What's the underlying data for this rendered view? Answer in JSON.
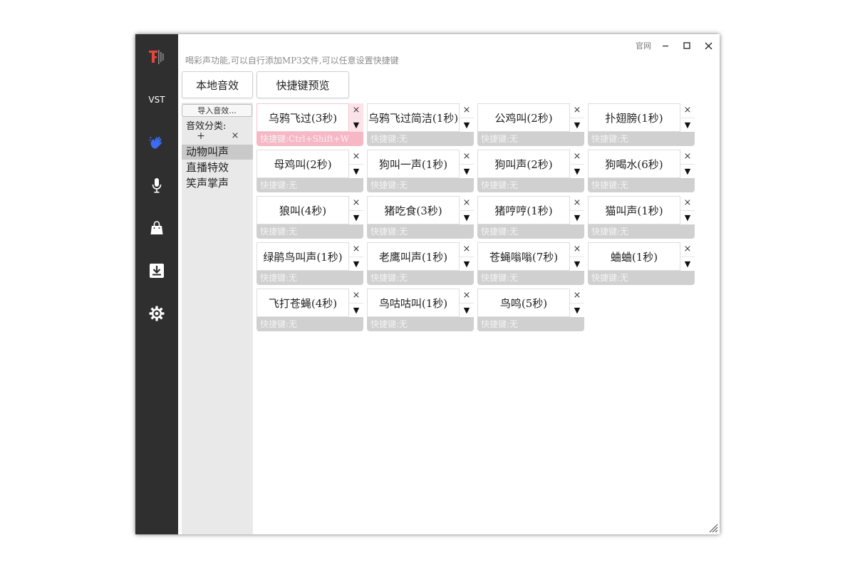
{
  "window": {
    "hint": "喝彩声功能,可以自行添加MP3文件,可以任意设置快捷键",
    "official_site": "官网",
    "minimize": "–",
    "maximize": "☐",
    "close": "✕"
  },
  "sidebar": {
    "items": [
      {
        "name": "logo-icon"
      },
      {
        "label": "VST"
      },
      {
        "name": "wave-hand-icon",
        "color": "#3b6cf6"
      },
      {
        "name": "microphone-icon"
      },
      {
        "name": "shopping-bag-icon"
      },
      {
        "name": "download-icon"
      },
      {
        "name": "gear-icon"
      }
    ]
  },
  "tabs": {
    "local": "本地音效",
    "preview": "快捷键预览"
  },
  "categories": {
    "import_label": "导入音效...",
    "title": "音效分类:",
    "add": "+",
    "remove": "×",
    "items": [
      "动物叫声",
      "直播特效",
      "笑声掌声"
    ],
    "selected": "动物叫声"
  },
  "sounds": [
    {
      "title": "乌鸦飞过(3秒)",
      "hotkey": "快捷键:Ctrl+Shift+W",
      "highlight": true
    },
    {
      "title": "乌鸦飞过简洁(1秒)",
      "hotkey": "快捷键:无"
    },
    {
      "title": "公鸡叫(2秒)",
      "hotkey": "快捷键:无"
    },
    {
      "title": "扑翅膀(1秒)",
      "hotkey": "快捷键:无"
    },
    {
      "title": "母鸡叫(2秒)",
      "hotkey": "快捷键:无"
    },
    {
      "title": "狗叫一声(1秒)",
      "hotkey": "快捷键:无"
    },
    {
      "title": "狗叫声(2秒)",
      "hotkey": "快捷键:无"
    },
    {
      "title": "狗喝水(6秒)",
      "hotkey": "快捷键:无"
    },
    {
      "title": "狼叫(4秒)",
      "hotkey": "快捷键:无"
    },
    {
      "title": "猪吃食(3秒)",
      "hotkey": "快捷键:无"
    },
    {
      "title": "猪哼哼(1秒)",
      "hotkey": "快捷键:无"
    },
    {
      "title": "猫叫声(1秒)",
      "hotkey": "快捷键:无"
    },
    {
      "title": "绿鹃鸟叫声(1秒)",
      "hotkey": "快捷键:无"
    },
    {
      "title": "老鹰叫声(1秒)",
      "hotkey": "快捷键:无"
    },
    {
      "title": "苍蝇嗡嗡(7秒)",
      "hotkey": "快捷键:无"
    },
    {
      "title": "蛐蛐(1秒)",
      "hotkey": "快捷键:无"
    },
    {
      "title": "飞打苍蝇(4秒)",
      "hotkey": "快捷键:无"
    },
    {
      "title": "鸟咕咕叫(1秒)",
      "hotkey": "快捷键:无"
    },
    {
      "title": "鸟鸣(5秒)",
      "hotkey": "快捷键:无"
    }
  ],
  "card_controls": {
    "remove": "×",
    "dropdown": "▼"
  }
}
